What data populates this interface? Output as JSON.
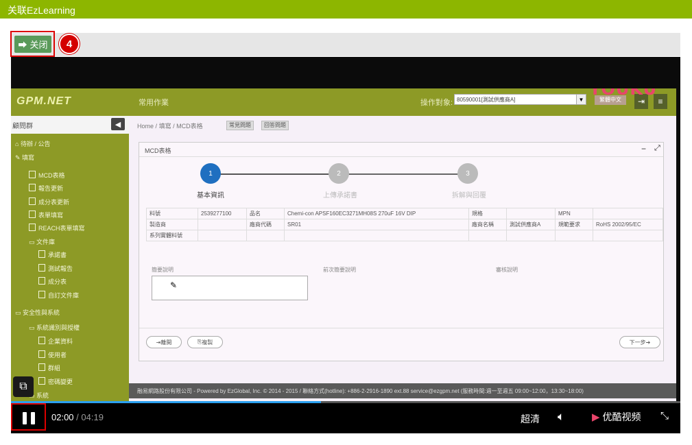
{
  "header": {
    "title": "关联EzLearning"
  },
  "toolbar": {
    "close_label": "关闭",
    "step_badge": "4"
  },
  "video": {
    "watermark": "YOUKU",
    "current_time": "02:00",
    "time_separator": "/",
    "duration": "04:19",
    "progress": 0.463,
    "quality_label": "超清",
    "brand_label": "优酷视频",
    "accent_color": "#2ba0f0"
  },
  "app": {
    "logo": "GPM.NET",
    "common_ops": "常用作業",
    "operation_target_label": "操作對象:",
    "operation_target_value": "80590001[測試供應商A]",
    "language": "繁體中文",
    "sidebar_header": "顧問群",
    "sidebar": {
      "item1": "待辦 / 公告",
      "item2": "填寫",
      "item3": "MCD表格",
      "item4": "報告更新",
      "item5": "成分表更新",
      "item6": "表單填寫",
      "item7": "REACH表單填寫",
      "item8": "文件庫",
      "item9": "承諾書",
      "item10": "測試報告",
      "item11": "成分表",
      "item12": "自訂文件庫",
      "item13": "安全性與系統",
      "item14": "系統識別與授權",
      "item15": "企業資料",
      "item16": "使用者",
      "item17": "群組",
      "item18": "密碼變更",
      "item19": "系統"
    },
    "breadcrumb": {
      "home": "Home",
      "sep1": "/",
      "l1": "填寫",
      "sep2": "/",
      "l2": "MCD表格"
    },
    "help_btn1": "常見問題",
    "help_btn2": "回答問題",
    "panel_title": "MCD表格",
    "steps": {
      "n1": "1",
      "n2": "2",
      "n3": "3",
      "l1": "基本資訊",
      "l2": "上傳承諾書",
      "l3": "拆解與回覆"
    },
    "table": {
      "c1": "料號",
      "c2": "2539277100",
      "c3": "品名",
      "c4": "Chemi-con APSF160EC3271MH08S 270uF 16V DIP",
      "c5": "規格",
      "c6": "MPN",
      "d1": "製造商",
      "d2": "廠商代碼",
      "d3": "SR01",
      "d4": "廠商名稱",
      "d5": "測試供應商A",
      "d6": "規範要求",
      "d7": "RoHS 2002/95/EC",
      "e1": "系列實體料號"
    },
    "fields": {
      "f1": "簡要說明",
      "f2": "前次簡要說明",
      "f3": "審核說明"
    },
    "btn_back": "離開",
    "btn_copy": "複製",
    "btn_next": "下一步",
    "footer": "融易網路股份有限公司 - Powered by EzGlobal, Inc. © 2014 - 2015 / 聯絡方式(hotline): +886-2-2916-1890 ext.88 service@ezgpm.net (服務時間:週一至週五 09:00~12:00，13:30~18:00)"
  }
}
